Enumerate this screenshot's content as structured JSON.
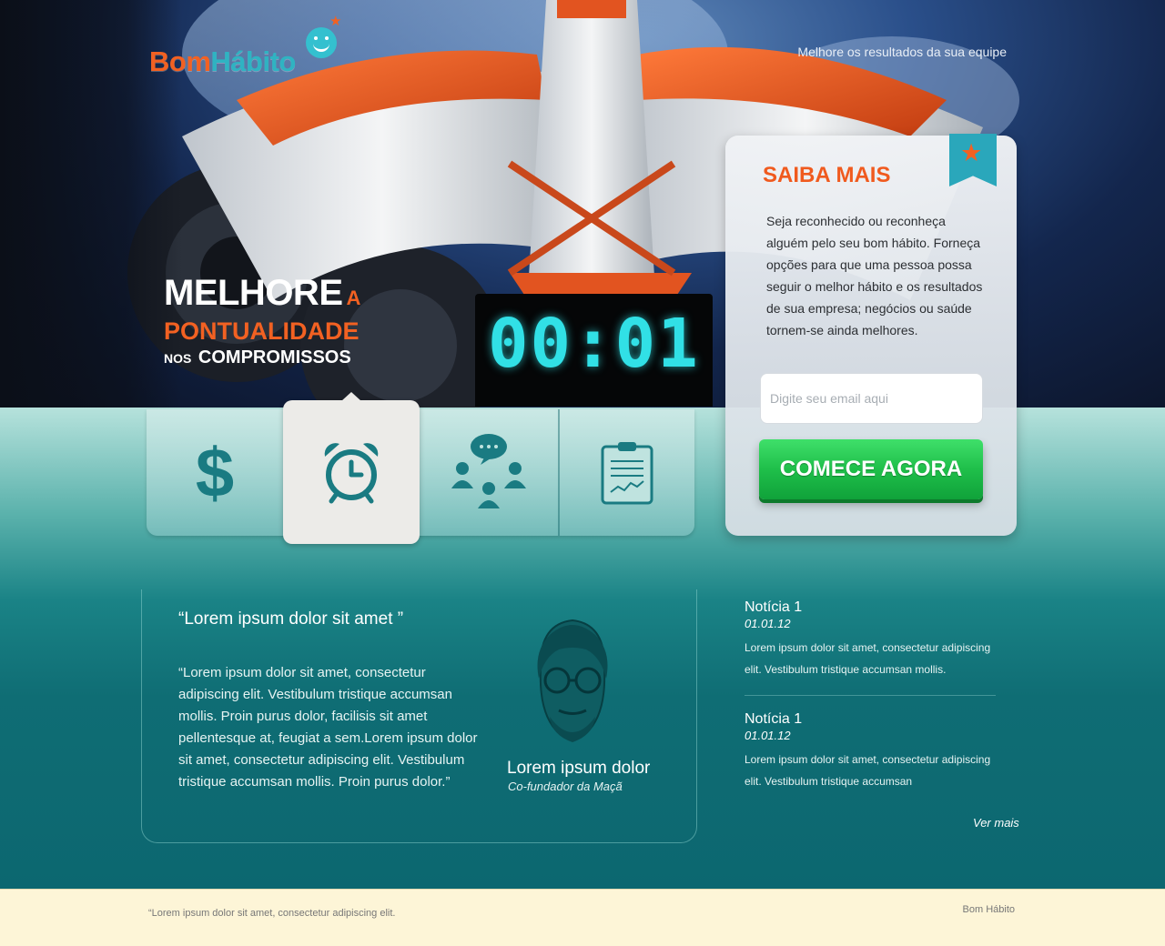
{
  "brand": {
    "name_part1": "Bom",
    "name_part2": "Hábito",
    "color_primary": "#f26122",
    "color_secondary": "#2fb3c2"
  },
  "header": {
    "tagline": "Melhore os resultados da sua equipe"
  },
  "hero": {
    "headline_1": "MELHORE",
    "headline_1_suffix": "A",
    "headline_2": "PONTUALIDADE",
    "headline_3_prefix": "NOS",
    "headline_3": "COMPROMISSOS",
    "clock_display": "00:01"
  },
  "tabs": [
    {
      "icon": "dollar-icon",
      "active": false
    },
    {
      "icon": "alarm-clock-icon",
      "active": true
    },
    {
      "icon": "team-chat-icon",
      "active": false
    },
    {
      "icon": "clipboard-chart-icon",
      "active": false
    }
  ],
  "panel": {
    "title": "SAIBA MAIS",
    "body": "Seja reconhecido ou reconheça alguém pelo seu bom hábito. Forneça opções para que uma pessoa possa seguir o melhor hábito e os resultados de sua empresa; negócios ou saúde tornem-se ainda melhores.",
    "email_placeholder": "Digite seu email aqui",
    "cta_label": "COMECE AGORA"
  },
  "testimonial": {
    "title": "“Lorem ipsum dolor sit amet ”",
    "body": "“Lorem ipsum dolor sit amet, consectetur adipiscing elit. Vestibulum tristique accumsan mollis. Proin purus dolor, facilisis sit amet pellentesque at, feugiat a sem.Lorem ipsum dolor sit amet, consectetur adipiscing elit. Vestibulum tristique accumsan mollis. Proin purus dolor.”",
    "author_name": "Lorem ipsum dolor",
    "author_role": "Co-fundador da Maçã"
  },
  "news": {
    "items": [
      {
        "title": "Notícia 1",
        "date": "01.01.12",
        "body": "Lorem ipsum dolor sit amet, consectetur adipiscing elit. Vestibulum tristique accumsan mollis."
      },
      {
        "title": "Notícia 1",
        "date": "01.01.12",
        "body": "Lorem ipsum dolor sit amet, consectetur adipiscing elit. Vestibulum tristique accumsan"
      }
    ],
    "more_label": "Ver mais"
  },
  "footer": {
    "quote": "“Lorem ipsum dolor sit amet, consectetur adipiscing elit.",
    "brand": "Bom Hábito"
  }
}
